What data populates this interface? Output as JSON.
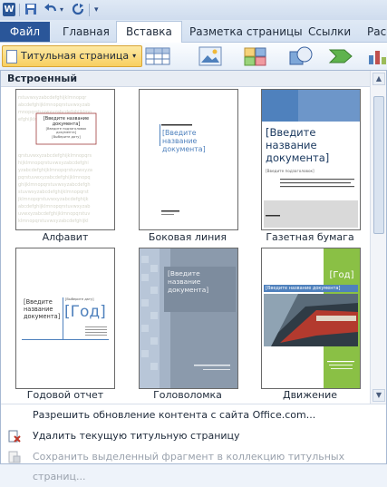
{
  "qat": {
    "word_icon": "W",
    "undo_icon": "undo-icon",
    "redo_icon": "redo-icon"
  },
  "tabs": {
    "file": "Файл",
    "items": [
      "Главная",
      "Вставка",
      "Разметка страницы",
      "Ссылки",
      "Расс"
    ],
    "active": "Вставка"
  },
  "ribbon": {
    "cover_button": "Титульная страница",
    "dropdown_arrow": "▾"
  },
  "gallery": {
    "header": "Встроенный",
    "items": [
      {
        "label": "Алфавит",
        "title": "[Введите название документа]",
        "subtitle": "[Введите подзаголовок документа]",
        "date": "[Выберите дату]"
      },
      {
        "label": "Боковая линия",
        "title": "[Введите название документа]"
      },
      {
        "label": "Газетная бумага",
        "title": "[Введите название документа]",
        "subtitle": "[Введите подзаголовок]"
      },
      {
        "label": "Годовой отчет",
        "title": "[Введите название документа]",
        "date": "[Выберите дату]",
        "year": "[Год]"
      },
      {
        "label": "Головоломка",
        "title": "[Введите название документа]"
      },
      {
        "label": "Движение",
        "title": "[Введите название документа]",
        "year": "[Год]"
      }
    ]
  },
  "menu": {
    "items": [
      {
        "label": "Разрешить обновление контента с сайта Office.com...",
        "enabled": true
      },
      {
        "label": "Удалить текущую титульную страницу",
        "enabled": true
      },
      {
        "label": "Сохранить выделенный фрагмент в коллекцию титульных страниц...",
        "enabled": false
      }
    ]
  },
  "colors": {
    "file_tab": "#2a5699",
    "accent_blue": "#4f81bd",
    "green": "#8ac045",
    "highlight": "#f8cf60"
  }
}
